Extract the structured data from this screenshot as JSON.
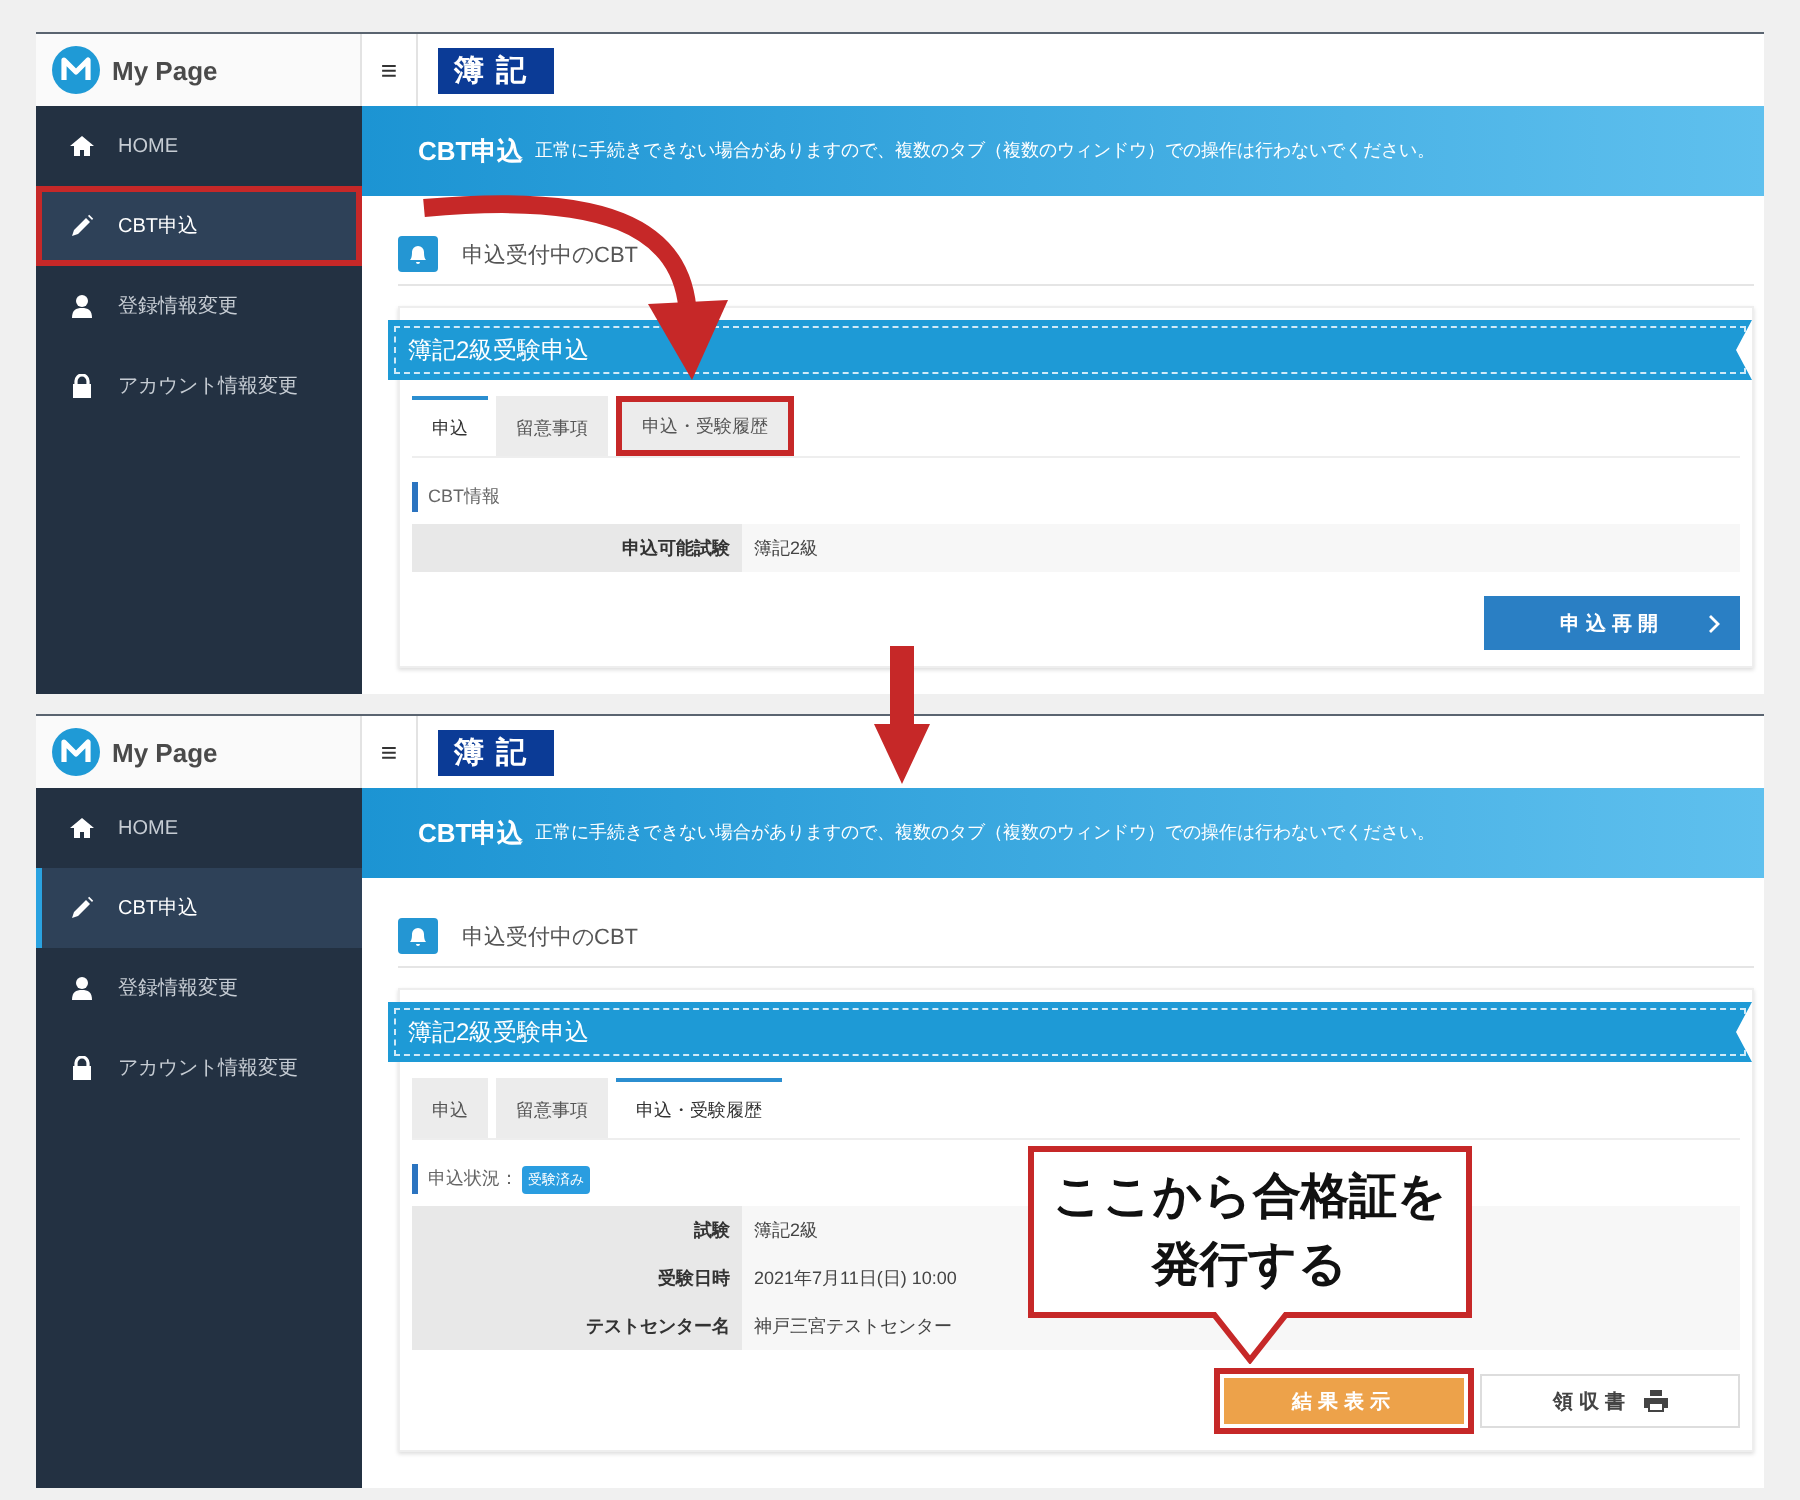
{
  "screens": [
    {
      "logo": "My Page",
      "menu_icon": "≡",
      "brand": "簿記",
      "sidebar": [
        {
          "label": "HOME",
          "kind": "home",
          "selected": false,
          "highlighted": false
        },
        {
          "label": "CBT申込",
          "kind": "pencil",
          "selected": true,
          "highlighted": true
        },
        {
          "label": "登録情報変更",
          "kind": "user",
          "selected": false,
          "highlighted": false
        },
        {
          "label": "アカウント情報変更",
          "kind": "lock",
          "selected": false,
          "highlighted": false
        }
      ],
      "banner": {
        "title": "CBT申込",
        "message": "正常に手続きできない場合がありますので、複数のタブ（複数のウィンドウ）での操作は行わないでください。"
      },
      "section_title": "申込受付中のCBT",
      "ribbon": "簿記2級受験申込",
      "tabs": [
        {
          "label": "申込",
          "selected": true,
          "highlighted": false
        },
        {
          "label": "留意事項",
          "selected": false,
          "highlighted": false
        },
        {
          "label": "申込・受験履歴",
          "selected": false,
          "highlighted": true
        }
      ],
      "info_label": "CBT情報",
      "rows": [
        {
          "label": "申込可能試験",
          "value": "簿記2級"
        }
      ],
      "buttons": [
        {
          "label": "申込再開",
          "kind": "primary",
          "highlighted": false
        }
      ]
    },
    {
      "logo": "My Page",
      "menu_icon": "≡",
      "brand": "簿記",
      "sidebar": [
        {
          "label": "HOME",
          "kind": "home",
          "selected": false,
          "highlighted": false
        },
        {
          "label": "CBT申込",
          "kind": "pencil",
          "selected": true,
          "highlighted": false
        },
        {
          "label": "登録情報変更",
          "kind": "user",
          "selected": false,
          "highlighted": false
        },
        {
          "label": "アカウント情報変更",
          "kind": "lock",
          "selected": false,
          "highlighted": false
        }
      ],
      "banner": {
        "title": "CBT申込",
        "message": "正常に手続きできない場合がありますので、複数のタブ（複数のウィンドウ）での操作は行わないでください。"
      },
      "section_title": "申込受付中のCBT",
      "ribbon": "簿記2級受験申込",
      "tabs": [
        {
          "label": "申込",
          "selected": false,
          "highlighted": false
        },
        {
          "label": "留意事項",
          "selected": false,
          "highlighted": false
        },
        {
          "label": "申込・受験履歴",
          "selected": true,
          "highlighted": false
        }
      ],
      "info_label": "申込状況：",
      "status_badge": "受験済み",
      "rows": [
        {
          "label": "試験",
          "value": "簿記2級"
        },
        {
          "label": "受験日時",
          "value": "2021年7月11日(日) 10:00"
        },
        {
          "label": "テストセンター名",
          "value": "神戸三宮テストセンター"
        }
      ],
      "buttons": [
        {
          "label": "結果表示",
          "kind": "result",
          "highlighted": true
        },
        {
          "label": "領収書",
          "kind": "receipt",
          "highlighted": false
        }
      ]
    }
  ],
  "callout": {
    "lines": [
      "ここから合格証を",
      "発行する"
    ]
  }
}
